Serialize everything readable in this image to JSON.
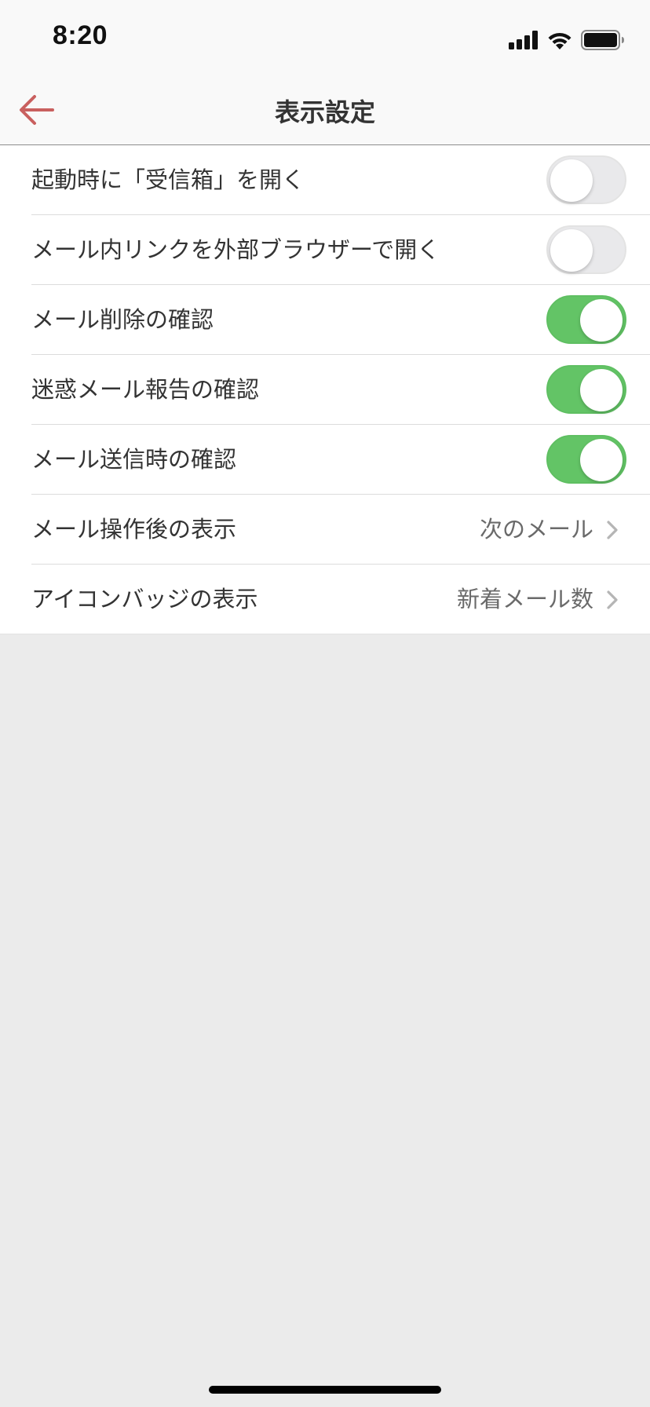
{
  "status_bar": {
    "time": "8:20",
    "icons": [
      "signal-icon",
      "wifi-icon",
      "battery-icon"
    ]
  },
  "nav": {
    "title": "表示設定",
    "back_icon": "arrow-left-icon",
    "accent_color": "#c9605f"
  },
  "settings": {
    "rows": [
      {
        "label": "起動時に「受信箱」を開く",
        "type": "toggle",
        "on": false
      },
      {
        "label": "メール内リンクを外部ブラウザーで開く",
        "type": "toggle",
        "on": false
      },
      {
        "label": "メール削除の確認",
        "type": "toggle",
        "on": true
      },
      {
        "label": "迷惑メール報告の確認",
        "type": "toggle",
        "on": true
      },
      {
        "label": "メール送信時の確認",
        "type": "toggle",
        "on": true
      },
      {
        "label": "メール操作後の表示",
        "type": "disclosure",
        "value": "次のメール"
      },
      {
        "label": "アイコンバッジの表示",
        "type": "disclosure",
        "value": "新着メール数"
      }
    ]
  },
  "colors": {
    "toggle_on": "#63c466",
    "toggle_off": "#e9e9eb",
    "background": "#ebebeb"
  }
}
